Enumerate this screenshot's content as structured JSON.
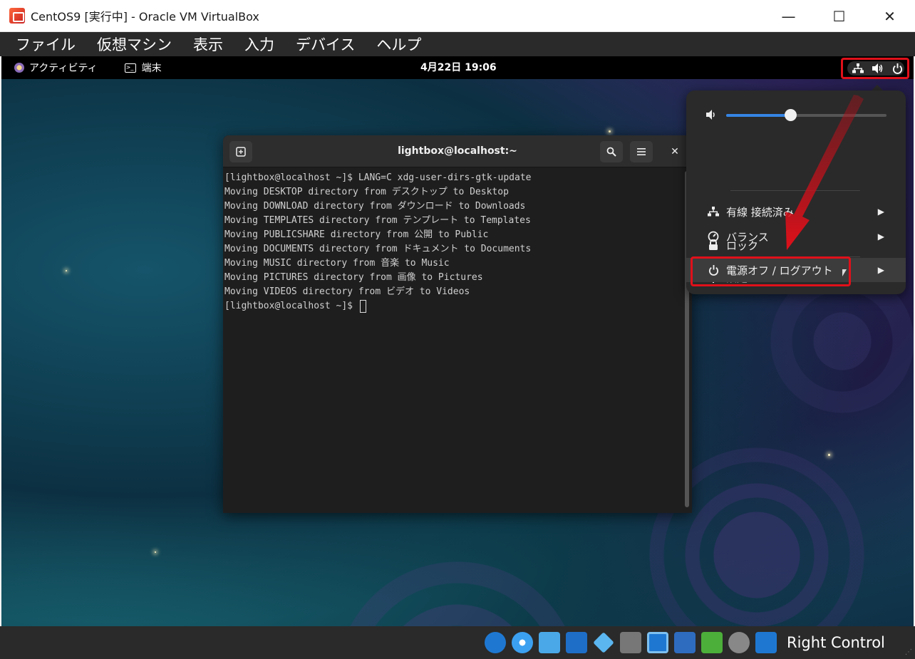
{
  "window": {
    "title": "CentOS9 [実行中] - Oracle VM VirtualBox",
    "controls": {
      "minimize": "—",
      "maximize": "☐",
      "close": "✕"
    }
  },
  "vbox_menu": [
    "ファイル",
    "仮想マシン",
    "表示",
    "入力",
    "デバイス",
    "ヘルプ"
  ],
  "gnome": {
    "activities": "アクティビティ",
    "app_name": "端末",
    "clock": "4月22日  19:06"
  },
  "terminal": {
    "title": "lightbox@localhost:~",
    "lines": [
      "[lightbox@localhost ~]$ LANG=C xdg-user-dirs-gtk-update",
      "Moving DESKTOP directory from デスクトップ to Desktop",
      "Moving DOWNLOAD directory from ダウンロード to Downloads",
      "Moving TEMPLATES directory from テンプレート to Templates",
      "Moving PUBLICSHARE directory from 公開 to Public",
      "Moving DOCUMENTS directory from ドキュメント to Documents",
      "Moving MUSIC directory from 音楽 to Music",
      "Moving PICTURES directory from 画像 to Pictures",
      "Moving VIDEOS directory from ビデオ to Videos"
    ],
    "prompt": "[lightbox@localhost ~]$ "
  },
  "system_menu": {
    "volume_level": 0.4,
    "wired": "有線 接続済み",
    "balance": "バランス",
    "settings": "設定",
    "lock": "ロック",
    "power": "電源オフ / ログアウト"
  },
  "status_bar": {
    "host_key": "Right Control",
    "icons": [
      "hard-disk-icon",
      "optical-drive-icon",
      "audio-icon",
      "network-icon",
      "usb-icon",
      "shared-folders-icon",
      "display-icon",
      "recording-icon",
      "cpu-icon",
      "mouse-integration-icon",
      "keyboard-capture-icon"
    ]
  },
  "colors": {
    "accent": "#3584e4",
    "annotation": "#e0101a"
  }
}
